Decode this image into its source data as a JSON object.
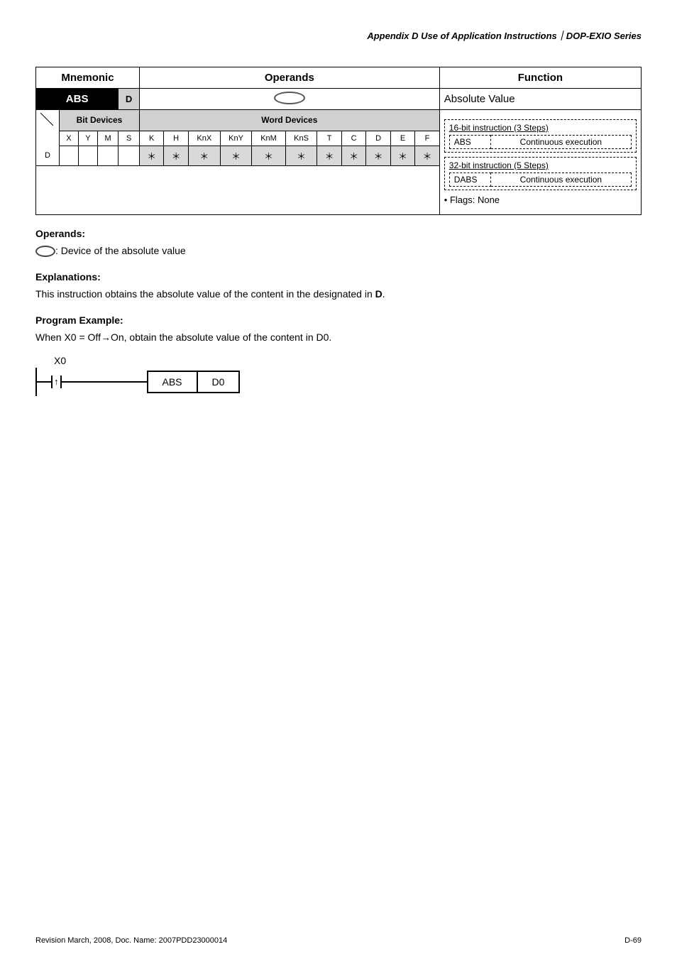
{
  "header": {
    "title": "Appendix D Use of Application Instructions｜DOP-EXIO Series"
  },
  "table": {
    "row1": {
      "mnemonic": "Mnemonic",
      "operands": "Operands",
      "function": "Function"
    },
    "row2": {
      "abs": "ABS",
      "d": "D",
      "absval": "Absolute Value"
    },
    "bit_header": "Bit Devices",
    "word_header": "Word Devices",
    "bit_cols": [
      "X",
      "Y",
      "M",
      "S"
    ],
    "word_cols": [
      "K",
      "H",
      "KnX",
      "KnY",
      "KnM",
      "KnS",
      "T",
      "C",
      "D",
      "E",
      "F"
    ],
    "d_row_label": "D",
    "star": "＊",
    "function_box": {
      "t16": "16-bit instruction (3 Steps)",
      "abs_label": "ABS",
      "cont": "Continuous execution",
      "t32": "32-bit instruction (5 Steps)",
      "dabs_label": "DABS",
      "flags": "Flags: None"
    }
  },
  "operands_section": {
    "heading": "Operands:",
    "text": ": Device of the absolute value"
  },
  "explanations_section": {
    "heading": "Explanations:",
    "text_pre": "This instruction obtains the absolute value of the content in the designated in ",
    "bold": "D",
    "text_post": "."
  },
  "example_section": {
    "heading": "Program Example:",
    "text": "When X0 = Off→On, obtain the absolute value of the content in D0."
  },
  "ladder": {
    "x0": "X0",
    "abs": "ABS",
    "d0": "D0"
  },
  "footer": {
    "left": "Revision March, 2008, Doc. Name: 2007PDD23000014",
    "right": "D-69"
  }
}
